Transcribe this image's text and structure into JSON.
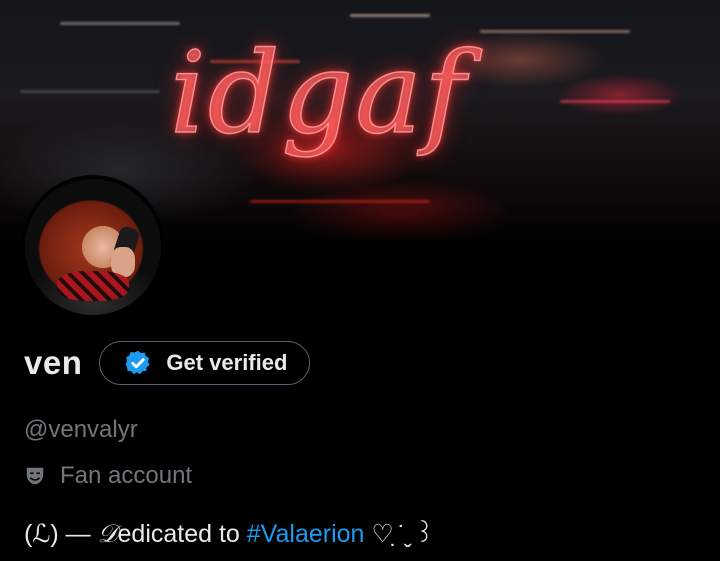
{
  "banner": {
    "text": "idgaf"
  },
  "profile": {
    "name": "ven",
    "verify_button_label": "Get verified",
    "handle": "@venvalyr",
    "category_label": "Fan account",
    "bio": {
      "prefix": "(ℒ) — ",
      "script_letter": "𝒟",
      "text": "edicated to ",
      "hashtag": "#Valaerion",
      "suffix": "  ♡ ̣̇  ̬ ꒱"
    }
  },
  "colors": {
    "accent": "#1d9bf0",
    "secondary_text": "#71767b",
    "background": "#000000",
    "verify_badge": "#1d9bf0"
  },
  "icons": {
    "verify": "verified-badge-icon",
    "category": "theater-mask-icon"
  }
}
